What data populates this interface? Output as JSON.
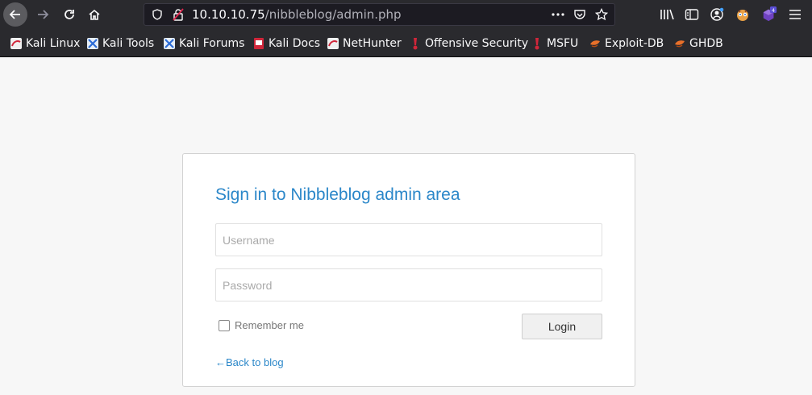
{
  "browser": {
    "url_host": "10.10.10.75",
    "url_path": "/nibbleblog/admin.php",
    "extension_badge": "4",
    "icons": {
      "back": "arrow-left-icon",
      "forward": "arrow-right-icon",
      "reload": "reload-icon",
      "home": "home-icon",
      "shield": "tracking-protection-shield-icon",
      "insecure": "insecure-lock-icon",
      "page_actions": "ellipsis-icon",
      "pocket": "pocket-icon",
      "bookmark_star": "star-icon",
      "library": "library-icon",
      "sidebar": "sidebar-icon",
      "account": "account-icon",
      "extension_face": "extension-face-icon",
      "extension_hex": "extension-icon",
      "menu": "hamburger-menu-icon"
    }
  },
  "bookmarks": [
    {
      "label": "Kali Linux",
      "icon": "kali-icon"
    },
    {
      "label": "Kali Tools",
      "icon": "kali-tools-icon"
    },
    {
      "label": "Kali Forums",
      "icon": "kali-forums-icon"
    },
    {
      "label": "Kali Docs",
      "icon": "kali-docs-icon"
    },
    {
      "label": "NetHunter",
      "icon": "nethunter-icon"
    },
    {
      "label": "Offensive Security",
      "icon": "offsec-icon"
    },
    {
      "label": "MSFU",
      "icon": "msfu-icon"
    },
    {
      "label": "Exploit-DB",
      "icon": "exploitdb-icon"
    },
    {
      "label": "GHDB",
      "icon": "ghdb-icon"
    }
  ],
  "login": {
    "title": "Sign in to Nibbleblog admin area",
    "username_placeholder": "Username",
    "password_placeholder": "Password",
    "remember_label": "Remember me",
    "login_button": "Login",
    "back_link": "←Back to blog"
  },
  "colors": {
    "accent": "#2b87c9",
    "toolbar": "#2a2a2e",
    "page_bg": "#f7f7f7"
  }
}
